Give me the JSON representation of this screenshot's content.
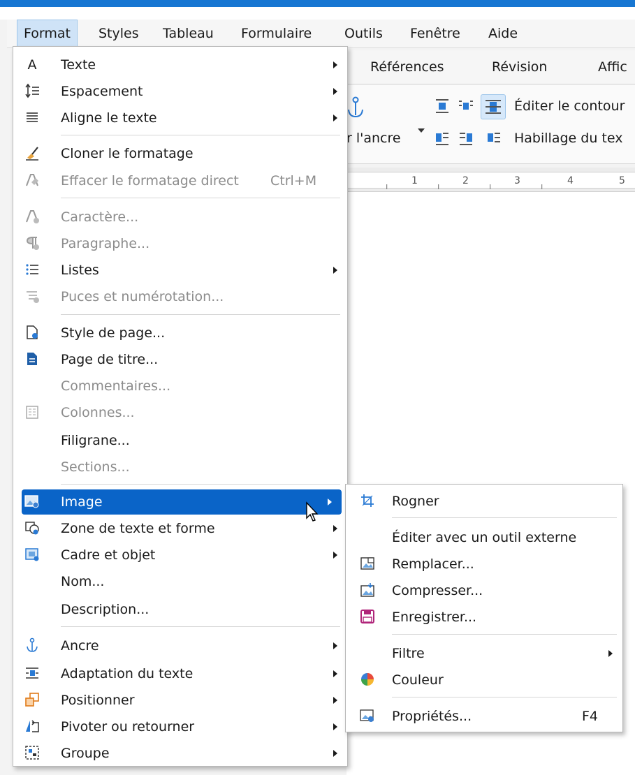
{
  "menubar": {
    "items": [
      {
        "label": "Format",
        "active": true
      },
      {
        "label": "Styles"
      },
      {
        "label": "Tableau"
      },
      {
        "label": "Formulaire"
      },
      {
        "label": "Outils"
      },
      {
        "label": "Fenêtre"
      },
      {
        "label": "Aide"
      }
    ]
  },
  "tabs": [
    "Références",
    "Révision",
    "Affic"
  ],
  "toolbar": {
    "anchor_label": "r l'ancre",
    "edit_contour_label": "Éditer le contour",
    "wrap_label": "Habillage du tex"
  },
  "ruler": {
    "numbers": [
      "1",
      "2",
      "3",
      "4",
      "5"
    ]
  },
  "format_menu": {
    "items": [
      {
        "label": "Texte",
        "icon": "text-A-icon",
        "submenu": true
      },
      {
        "label": "Espacement",
        "icon": "spacing-icon",
        "submenu": true
      },
      {
        "label": "Aligne le texte",
        "icon": "align-text-icon",
        "submenu": true
      },
      {
        "label": "Cloner le formatage",
        "icon": "clone-brush-icon"
      },
      {
        "label": "Effacer le formatage direct",
        "shortcut": "Ctrl+M",
        "icon": "clear-format-icon",
        "disabled": true
      },
      {
        "label": "Caractère...",
        "icon": "character-icon",
        "disabled": true
      },
      {
        "label": "Paragraphe...",
        "icon": "paragraph-icon",
        "disabled": true
      },
      {
        "label": "Listes",
        "icon": "list-icon",
        "submenu": true
      },
      {
        "label": "Puces et numérotation...",
        "icon": "bullets-icon",
        "disabled": true
      },
      {
        "label": "Style de page...",
        "icon": "page-style-icon"
      },
      {
        "label": "Page de titre...",
        "icon": "title-page-icon"
      },
      {
        "label": "Commentaires...",
        "disabled": true
      },
      {
        "label": "Colonnes...",
        "icon": "columns-icon",
        "disabled": true
      },
      {
        "label": "Filigrane..."
      },
      {
        "label": "Sections...",
        "disabled": true
      },
      {
        "label": "Image",
        "icon": "image-icon",
        "submenu": true,
        "highlighted": true
      },
      {
        "label": "Zone de texte et forme",
        "icon": "textbox-shape-icon",
        "submenu": true
      },
      {
        "label": "Cadre et objet",
        "icon": "frame-object-icon",
        "submenu": true
      },
      {
        "label": "Nom..."
      },
      {
        "label": "Description..."
      },
      {
        "label": "Ancre",
        "icon": "anchor-icon",
        "submenu": true
      },
      {
        "label": "Adaptation du texte",
        "icon": "text-wrap-icon",
        "submenu": true
      },
      {
        "label": "Positionner",
        "icon": "position-icon",
        "submenu": true
      },
      {
        "label": "Pivoter ou retourner",
        "icon": "rotate-flip-icon",
        "submenu": true
      },
      {
        "label": "Groupe",
        "icon": "group-icon",
        "submenu": true
      }
    ]
  },
  "image_submenu": {
    "items": [
      {
        "label": "Rogner",
        "icon": "crop-icon"
      },
      {
        "label": "Éditer avec un outil externe"
      },
      {
        "label": "Remplacer...",
        "icon": "replace-image-icon"
      },
      {
        "label": "Compresser...",
        "icon": "compress-image-icon"
      },
      {
        "label": "Enregistrer...",
        "icon": "save-icon"
      },
      {
        "label": "Filtre",
        "submenu": true
      },
      {
        "label": "Couleur",
        "icon": "color-wheel-icon"
      },
      {
        "label": "Propriétés...",
        "shortcut": "F4",
        "icon": "image-properties-icon"
      }
    ]
  },
  "colors": {
    "highlight": "#0a64c8",
    "title_strip": "#1776d2",
    "disabled_text": "#8c8c8c",
    "menu_active": "#cfe3f7"
  }
}
